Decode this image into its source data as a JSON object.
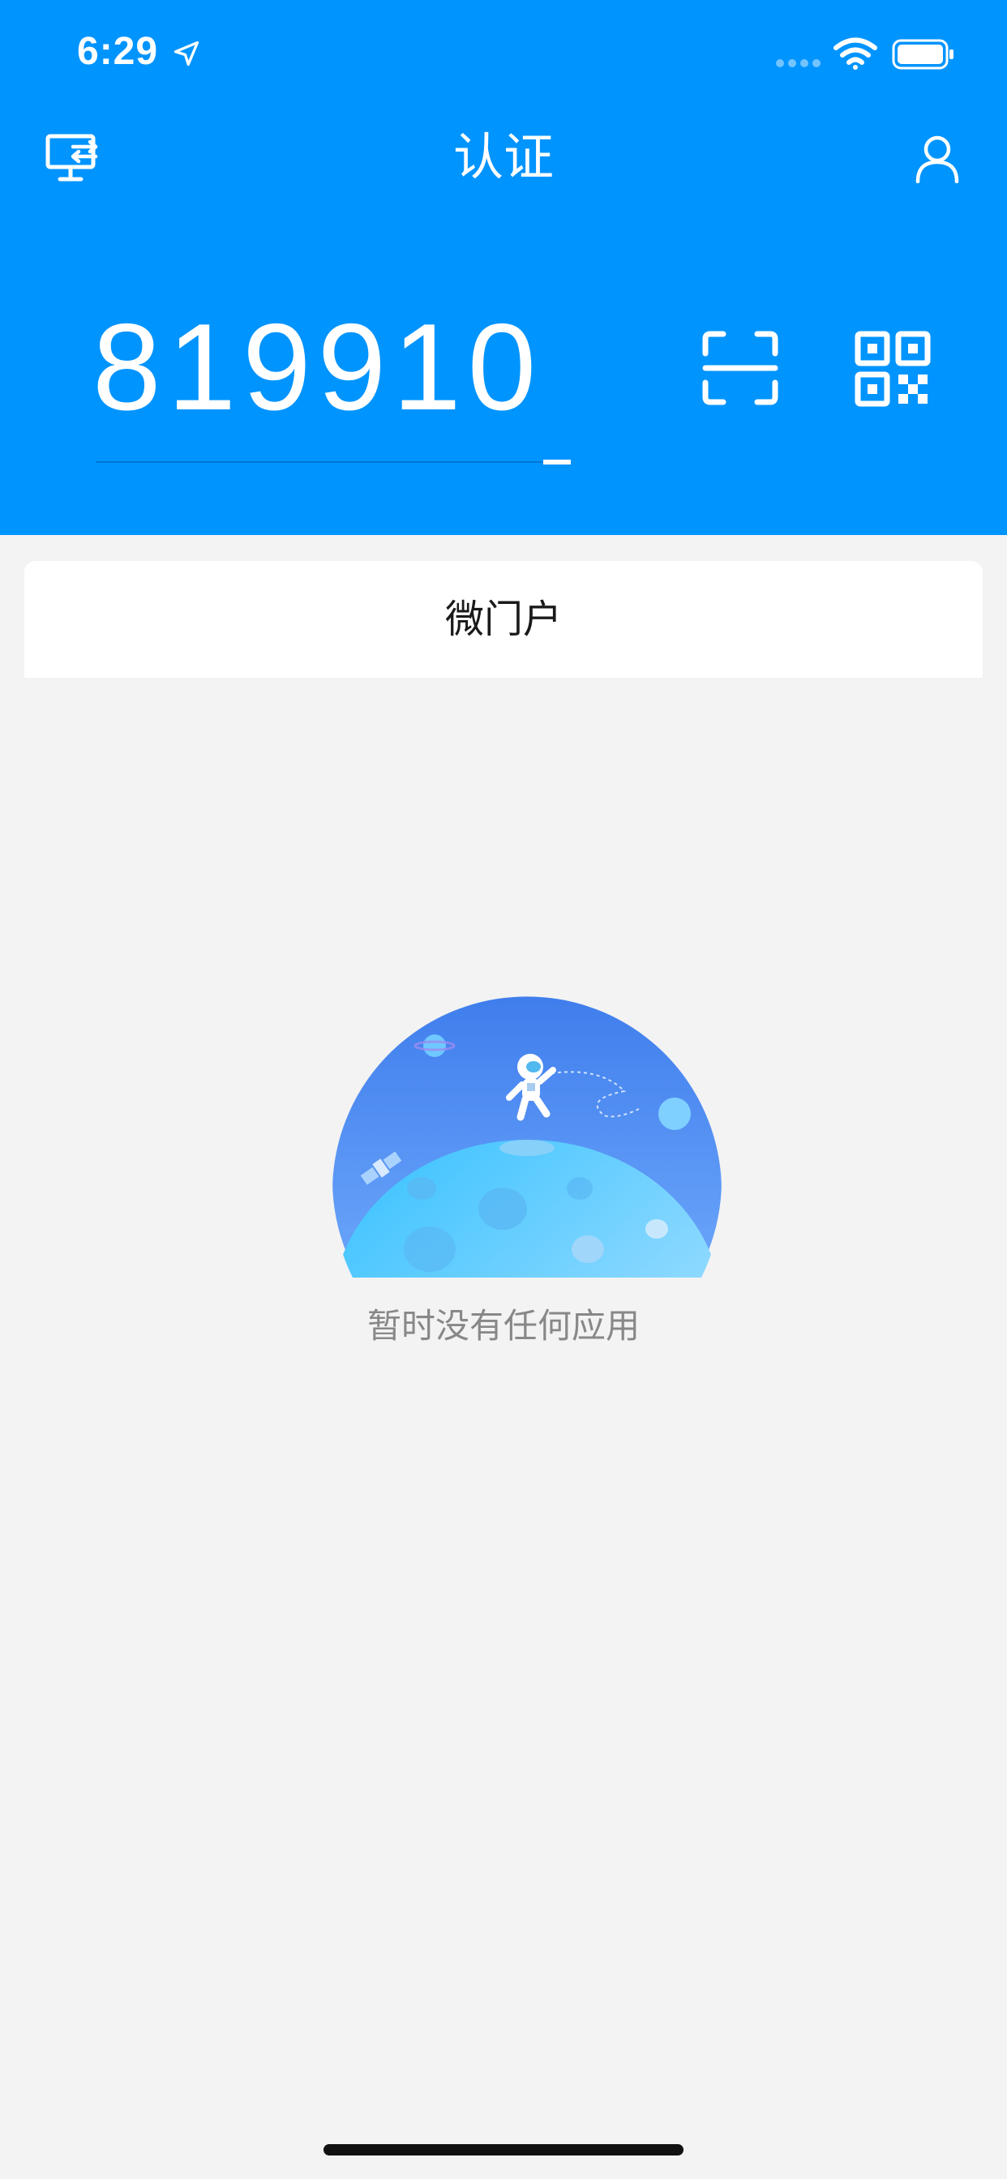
{
  "status_bar": {
    "time": "6:29",
    "icons": [
      "location-arrow-icon",
      "signal-icon",
      "wifi-icon",
      "battery-icon"
    ]
  },
  "nav": {
    "title": "认证",
    "left_icon": "monitor-icon",
    "right_icon": "user-icon"
  },
  "auth": {
    "code": "819910",
    "actions": [
      "scan-icon",
      "qr-code-icon"
    ]
  },
  "tabs": [
    {
      "label": "微门户"
    }
  ],
  "empty_state": {
    "message": "暂时没有任何应用",
    "illustration": "astronaut-planet-illustration"
  },
  "colors": {
    "primary": "#0094fe",
    "background": "#f3f3f3",
    "card": "#ffffff",
    "empty_text": "#888888"
  }
}
